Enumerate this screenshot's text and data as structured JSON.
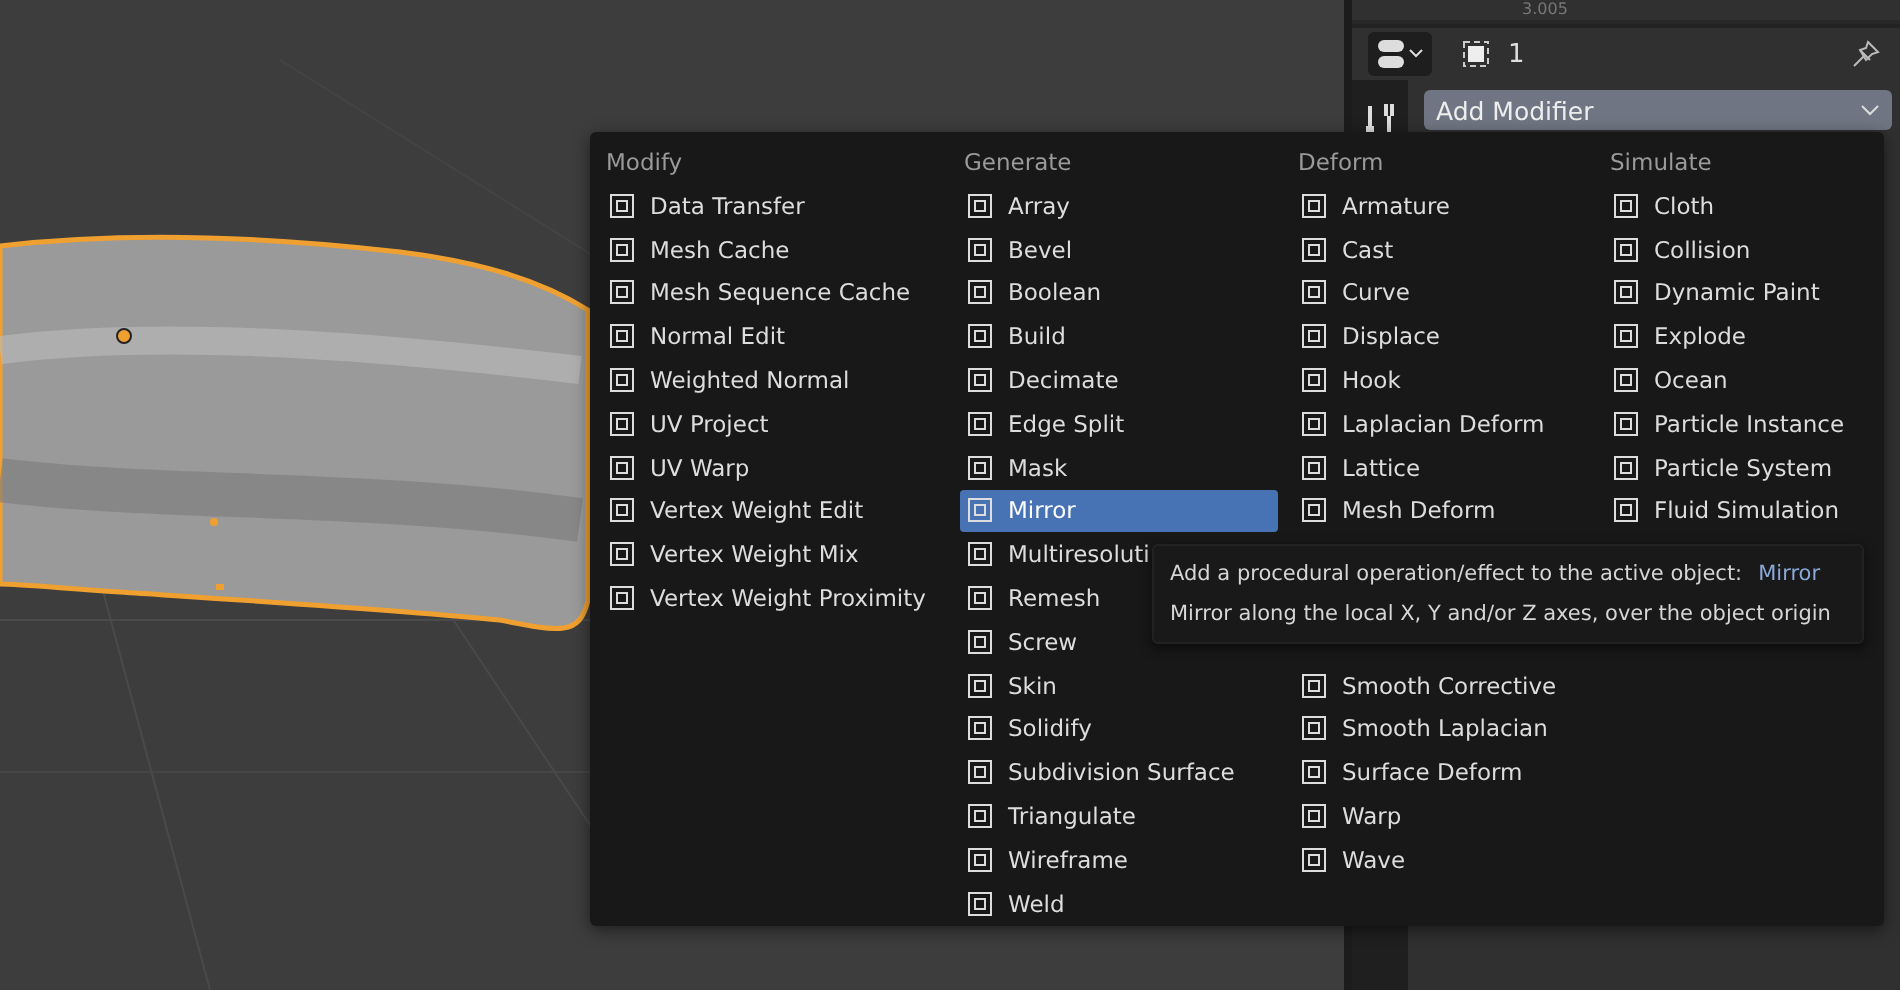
{
  "properties_panel": {
    "top_value": "3.005",
    "object_count": "1",
    "add_modifier": "Add Modifier"
  },
  "menu": {
    "columns": [
      {
        "header": "Modify",
        "items": [
          {
            "label": "Data Transfer",
            "selected": false
          },
          {
            "label": "Mesh Cache",
            "selected": false
          },
          {
            "label": "Mesh Sequence Cache",
            "selected": false
          },
          {
            "label": "Normal Edit",
            "selected": false
          },
          {
            "label": "Weighted Normal",
            "selected": false
          },
          {
            "label": "UV Project",
            "selected": false
          },
          {
            "label": "UV Warp",
            "selected": false
          },
          {
            "label": "Vertex Weight Edit",
            "selected": false
          },
          {
            "label": "Vertex Weight Mix",
            "selected": false
          },
          {
            "label": "Vertex Weight Proximity",
            "selected": false
          }
        ]
      },
      {
        "header": "Generate",
        "items": [
          {
            "label": "Array",
            "selected": false
          },
          {
            "label": "Bevel",
            "selected": false
          },
          {
            "label": "Boolean",
            "selected": false
          },
          {
            "label": "Build",
            "selected": false
          },
          {
            "label": "Decimate",
            "selected": false
          },
          {
            "label": "Edge Split",
            "selected": false
          },
          {
            "label": "Mask",
            "selected": false
          },
          {
            "label": "Mirror",
            "selected": true
          },
          {
            "label": "Multiresoluti",
            "selected": false
          },
          {
            "label": "Remesh",
            "selected": false
          },
          {
            "label": "Screw",
            "selected": false
          },
          {
            "label": "Skin",
            "selected": false
          },
          {
            "label": "Solidify",
            "selected": false
          },
          {
            "label": "Subdivision Surface",
            "selected": false
          },
          {
            "label": "Triangulate",
            "selected": false
          },
          {
            "label": "Wireframe",
            "selected": false
          },
          {
            "label": "Weld",
            "selected": false
          }
        ]
      },
      {
        "header": "Deform",
        "items": [
          {
            "label": "Armature",
            "selected": false
          },
          {
            "label": "Cast",
            "selected": false
          },
          {
            "label": "Curve",
            "selected": false
          },
          {
            "label": "Displace",
            "selected": false
          },
          {
            "label": "Hook",
            "selected": false
          },
          {
            "label": "Laplacian Deform",
            "selected": false
          },
          {
            "label": "Lattice",
            "selected": false
          },
          {
            "label": "Mesh Deform",
            "selected": false
          }
        ],
        "items_below_tooltip": [
          {
            "label": "Smooth Corrective",
            "selected": false
          },
          {
            "label": "Smooth Laplacian",
            "selected": false
          },
          {
            "label": "Surface Deform",
            "selected": false
          },
          {
            "label": "Warp",
            "selected": false
          },
          {
            "label": "Wave",
            "selected": false
          }
        ]
      },
      {
        "header": "Simulate",
        "items": [
          {
            "label": "Cloth",
            "selected": false
          },
          {
            "label": "Collision",
            "selected": false
          },
          {
            "label": "Dynamic Paint",
            "selected": false
          },
          {
            "label": "Explode",
            "selected": false
          },
          {
            "label": "Ocean",
            "selected": false
          },
          {
            "label": "Particle Instance",
            "selected": false
          },
          {
            "label": "Particle System",
            "selected": false
          },
          {
            "label": "Fluid Simulation",
            "selected": false
          }
        ]
      }
    ]
  },
  "tooltip": {
    "description": "Add a procedural operation/effect to the active object:",
    "name": "Mirror",
    "detail": "Mirror along the local X, Y and/or Z axes, over the object origin"
  }
}
